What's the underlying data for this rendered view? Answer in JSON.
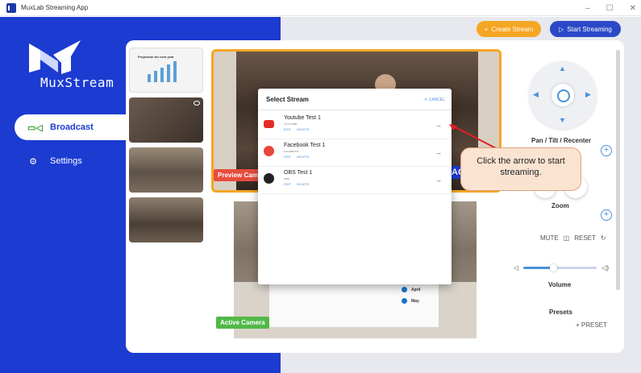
{
  "window": {
    "title": "MuxLab Streaming App",
    "minimize": "–",
    "maximize": "☐",
    "close": "✕"
  },
  "brand": {
    "name": "MuxStream"
  },
  "nav": {
    "items": [
      {
        "label": "Broadcast",
        "icon": "camera-icon",
        "active": true
      },
      {
        "label": "Settings",
        "icon": "gear-icon",
        "active": false
      }
    ]
  },
  "toolbar": {
    "create_label": "Create Stream",
    "create_icon": "+",
    "start_label": "Start Streaming",
    "start_icon": "▷"
  },
  "thumbnails": {
    "slide_title": "Projection for next year"
  },
  "preview": {
    "label": "Preview Camera",
    "badge": "ACTIVE"
  },
  "active_camera": {
    "label": "Active Camera",
    "slide_items": [
      "April",
      "May"
    ]
  },
  "controls": {
    "pan_tilt_label": "Pan / Tilt / Recenter",
    "zoom_label": "Zoom",
    "mute_label": "MUTE",
    "reset_label": "RESET",
    "volume_label": "Volume",
    "volume_level": 0.4,
    "presets_label": "Presets",
    "add_preset_label": "+ PRESET"
  },
  "modal": {
    "title": "Select Stream",
    "cancel_label": "✕ CANCEL",
    "streams": [
      {
        "name": "Youtube Test 1",
        "type": "YOUTUBE",
        "edit": "EDIT",
        "delete": "DELETE",
        "icon": "youtube-icon",
        "color": "#e52d27"
      },
      {
        "name": "Facebook Test 1",
        "type": "FACEBOOK",
        "edit": "EDIT",
        "delete": "DELETE",
        "icon": "facebook-icon",
        "color": "#e8453c"
      },
      {
        "name": "OBS Test 1",
        "type": "OBS",
        "edit": "EDIT",
        "delete": "DELETE",
        "icon": "obs-icon",
        "color": "#222222"
      }
    ]
  },
  "callout": {
    "text": "Click the arrow to start streaming."
  },
  "colors": {
    "sidebar": "#1c3bd1",
    "accent": "#f5a623",
    "primary": "#2b49c7",
    "preview_border": "#f5a623"
  }
}
